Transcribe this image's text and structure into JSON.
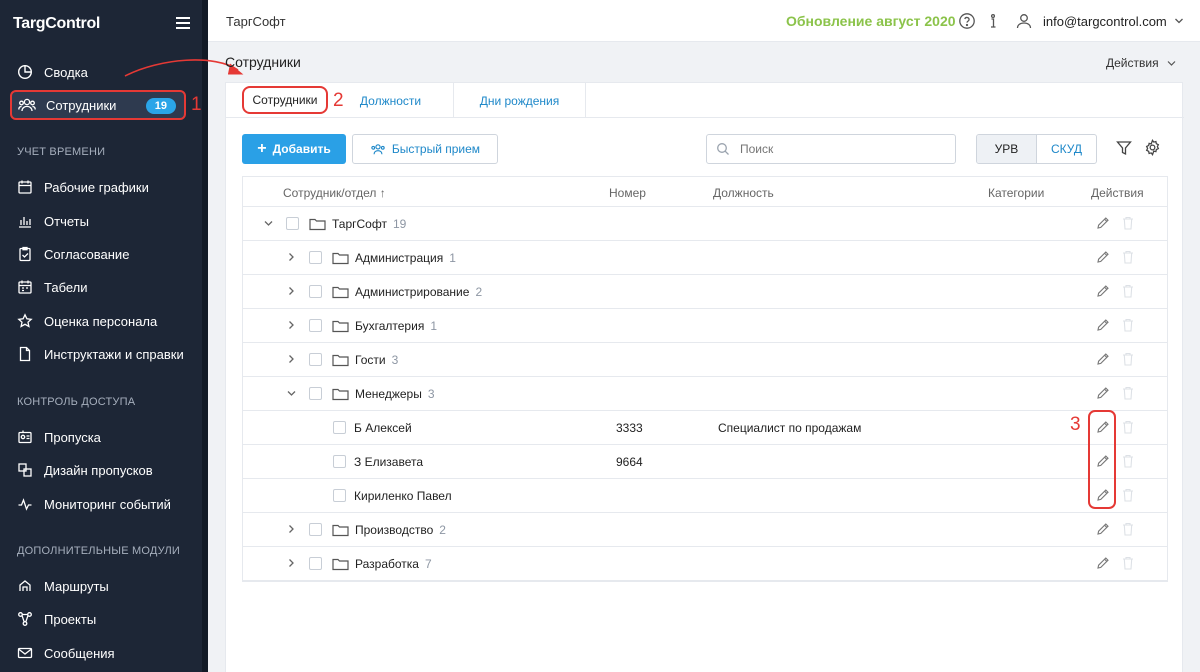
{
  "app": {
    "logo": "TargControl"
  },
  "sidebar": {
    "items_top": [
      {
        "label": "Сводка",
        "icon": "pie-chart-icon"
      },
      {
        "label": "Сотрудники",
        "icon": "users-icon",
        "badge": "19"
      }
    ],
    "section_time": "УЧЕТ ВРЕМЕНИ",
    "items_time": [
      {
        "label": "Рабочие графики",
        "icon": "calendar-icon"
      },
      {
        "label": "Отчеты",
        "icon": "bar-chart-icon"
      },
      {
        "label": "Согласование",
        "icon": "clipboard-check-icon"
      },
      {
        "label": "Табели",
        "icon": "calendar-grid-icon"
      },
      {
        "label": "Оценка персонала",
        "icon": "star-icon"
      },
      {
        "label": "Инструктажи и справки",
        "icon": "document-icon"
      }
    ],
    "section_access": "КОНТРОЛЬ ДОСТУПА",
    "items_access": [
      {
        "label": "Пропуска",
        "icon": "badge-icon"
      },
      {
        "label": "Дизайн пропусков",
        "icon": "design-icon"
      },
      {
        "label": "Мониторинг событий",
        "icon": "monitoring-icon"
      }
    ],
    "section_modules": "ДОПОЛНИТЕЛЬНЫЕ МОДУЛИ",
    "items_modules": [
      {
        "label": "Маршруты",
        "icon": "route-icon"
      },
      {
        "label": "Проекты",
        "icon": "projects-icon"
      },
      {
        "label": "Сообщения",
        "icon": "mail-icon"
      }
    ]
  },
  "topbar": {
    "company": "ТаргСофт",
    "update_link": "Обновление август 2020",
    "user_email": "info@targcontrol.com"
  },
  "page": {
    "title": "Сотрудники",
    "actions_label": "Действия"
  },
  "tabs": [
    {
      "label": "Сотрудники",
      "active": true
    },
    {
      "label": "Должности",
      "active": false
    },
    {
      "label": "Дни рождения",
      "active": false
    }
  ],
  "toolbar": {
    "add_label": "Добавить",
    "quick_label": "Быстрый прием",
    "search_placeholder": "Поиск",
    "seg_urv": "УРВ",
    "seg_skud": "СКУД"
  },
  "table": {
    "columns": [
      "Сотрудник/отдел",
      "Номер",
      "Должность",
      "Категории",
      "Действия"
    ],
    "rows": [
      {
        "type": "folder",
        "level": 0,
        "expanded": true,
        "name": "ТаргСофт",
        "count": "19"
      },
      {
        "type": "folder",
        "level": 1,
        "expanded": false,
        "name": "Администрация",
        "count": "1"
      },
      {
        "type": "folder",
        "level": 1,
        "expanded": false,
        "name": "Администрирование",
        "count": "2"
      },
      {
        "type": "folder",
        "level": 1,
        "expanded": false,
        "name": "Бухгалтерия",
        "count": "1"
      },
      {
        "type": "folder",
        "level": 1,
        "expanded": false,
        "name": "Гости",
        "count": "3"
      },
      {
        "type": "folder",
        "level": 1,
        "expanded": true,
        "name": "Менеджеры",
        "count": "3"
      },
      {
        "type": "person",
        "level": 2,
        "name": "Б Алексей",
        "number": "3333",
        "position": "Специалист по продажам"
      },
      {
        "type": "person",
        "level": 2,
        "name": "З Елизавета",
        "number": "9664",
        "position": ""
      },
      {
        "type": "person",
        "level": 2,
        "name": "Кириленко Павел",
        "number": "",
        "position": ""
      },
      {
        "type": "folder",
        "level": 1,
        "expanded": false,
        "name": "Производство",
        "count": "2"
      },
      {
        "type": "folder",
        "level": 1,
        "expanded": false,
        "name": "Разработка",
        "count": "7"
      }
    ]
  },
  "annotations": {
    "n1": "1",
    "n2": "2",
    "n3": "3"
  },
  "colors": {
    "accent": "#2aa0e6",
    "sidebar_bg": "#1d2636",
    "update": "#8bc34a",
    "annotation": "#e53935"
  }
}
